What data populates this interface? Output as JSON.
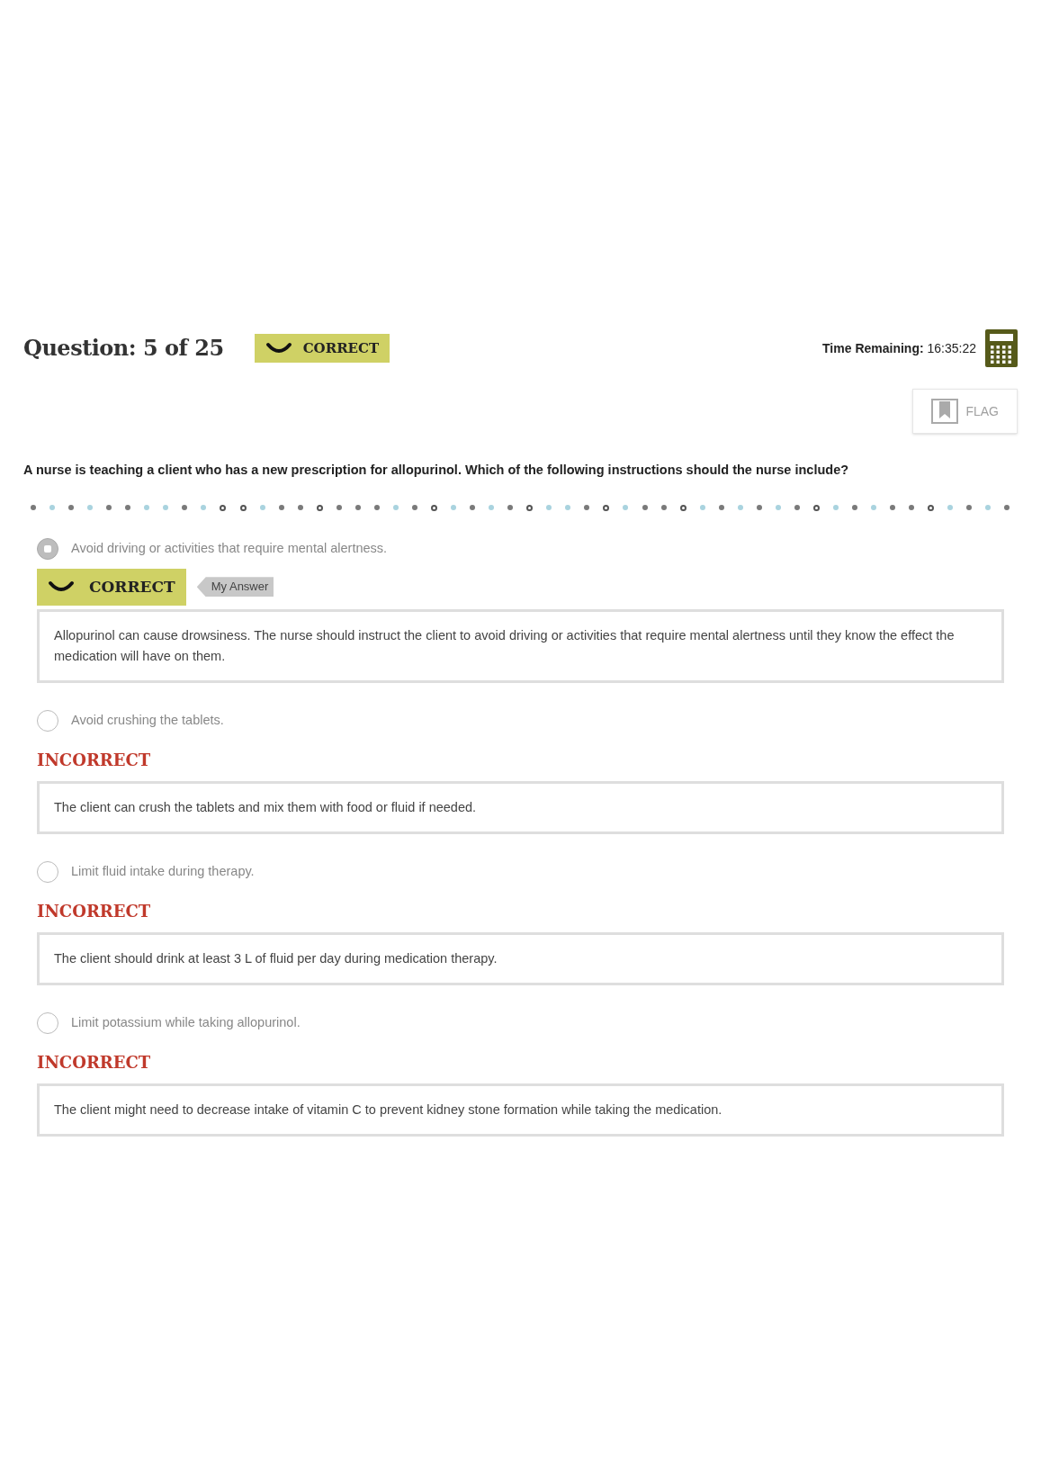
{
  "header": {
    "question_counter": "Question: 5 of 25",
    "result_badge": {
      "label": "CORRECT",
      "kind": "correct"
    },
    "time_label": "Time Remaining:",
    "time_value": "16:35:22",
    "flag": {
      "label": "FLAG",
      "flagged": false
    }
  },
  "question": "A nurse is teaching a client who has a new prescription for allopurinol. Which of the following instructions should the nurse include?",
  "progress_dots": [
    {
      "kind": "dot",
      "color": "#7a7a7a"
    },
    {
      "kind": "dot",
      "color": "#a9d3df"
    },
    {
      "kind": "dot",
      "color": "#7a7a7a"
    },
    {
      "kind": "dot",
      "color": "#a9d3df"
    },
    {
      "kind": "dot",
      "color": "#7a7a7a"
    },
    {
      "kind": "dot",
      "color": "#7a7a7a"
    },
    {
      "kind": "dot",
      "color": "#a9d3df"
    },
    {
      "kind": "dot",
      "color": "#a9d3df"
    },
    {
      "kind": "dot",
      "color": "#7a7a7a"
    },
    {
      "kind": "dot",
      "color": "#a9d3df"
    },
    {
      "kind": "ring",
      "color": "#555555"
    },
    {
      "kind": "ring",
      "color": "#555555"
    },
    {
      "kind": "dot",
      "color": "#a9d3df"
    },
    {
      "kind": "dot",
      "color": "#7a7a7a"
    },
    {
      "kind": "dot",
      "color": "#7a7a7a"
    },
    {
      "kind": "ring",
      "color": "#555555"
    },
    {
      "kind": "dot",
      "color": "#7a7a7a"
    },
    {
      "kind": "dot",
      "color": "#7a7a7a"
    },
    {
      "kind": "dot",
      "color": "#7a7a7a"
    },
    {
      "kind": "dot",
      "color": "#a9d3df"
    },
    {
      "kind": "dot",
      "color": "#7a7a7a"
    },
    {
      "kind": "ring",
      "color": "#555555"
    },
    {
      "kind": "dot",
      "color": "#a9d3df"
    },
    {
      "kind": "dot",
      "color": "#7a7a7a"
    },
    {
      "kind": "dot",
      "color": "#a9d3df"
    },
    {
      "kind": "dot",
      "color": "#7a7a7a"
    },
    {
      "kind": "ring",
      "color": "#555555"
    },
    {
      "kind": "dot",
      "color": "#a9d3df"
    },
    {
      "kind": "dot",
      "color": "#a9d3df"
    },
    {
      "kind": "dot",
      "color": "#7a7a7a"
    },
    {
      "kind": "ring",
      "color": "#555555"
    },
    {
      "kind": "dot",
      "color": "#a9d3df"
    },
    {
      "kind": "dot",
      "color": "#7a7a7a"
    },
    {
      "kind": "dot",
      "color": "#7a7a7a"
    },
    {
      "kind": "ring",
      "color": "#555555"
    },
    {
      "kind": "dot",
      "color": "#a9d3df"
    },
    {
      "kind": "dot",
      "color": "#7a7a7a"
    },
    {
      "kind": "dot",
      "color": "#a9d3df"
    },
    {
      "kind": "dot",
      "color": "#7a7a7a"
    },
    {
      "kind": "dot",
      "color": "#a9d3df"
    },
    {
      "kind": "dot",
      "color": "#7a7a7a"
    },
    {
      "kind": "ring",
      "color": "#555555"
    },
    {
      "kind": "dot",
      "color": "#a9d3df"
    },
    {
      "kind": "dot",
      "color": "#7a7a7a"
    },
    {
      "kind": "dot",
      "color": "#a9d3df"
    },
    {
      "kind": "dot",
      "color": "#7a7a7a"
    },
    {
      "kind": "dot",
      "color": "#7a7a7a"
    },
    {
      "kind": "ring",
      "color": "#555555"
    },
    {
      "kind": "dot",
      "color": "#a9d3df"
    },
    {
      "kind": "dot",
      "color": "#7a7a7a"
    },
    {
      "kind": "dot",
      "color": "#a9d3df"
    },
    {
      "kind": "dot",
      "color": "#7a7a7a"
    }
  ],
  "options": [
    {
      "text": "Avoid driving or activities that require mental alertness.",
      "selected": true,
      "result": {
        "kind": "correct",
        "label": "CORRECT"
      },
      "my_answer_tag": "My Answer",
      "rationale": "Allopurinol can cause drowsiness. The nurse should instruct the client to avoid driving or activities that require mental alertness until they know the effect the medication will have on them."
    },
    {
      "text": "Avoid crushing the tablets.",
      "selected": false,
      "result": {
        "kind": "incorrect",
        "label": "INCORRECT"
      },
      "rationale": "The client can crush the tablets and mix them with food or fluid if needed."
    },
    {
      "text": "Limit fluid intake during therapy.",
      "selected": false,
      "result": {
        "kind": "incorrect",
        "label": "INCORRECT"
      },
      "rationale": "The client should drink at least 3 L of fluid per day during medication therapy."
    },
    {
      "text": "Limit potassium while taking allopurinol.",
      "selected": false,
      "result": {
        "kind": "incorrect",
        "label": "INCORRECT"
      },
      "rationale": "The client might need to decrease intake of vitamin C to prevent kidney stone formation while taking the medication."
    }
  ]
}
